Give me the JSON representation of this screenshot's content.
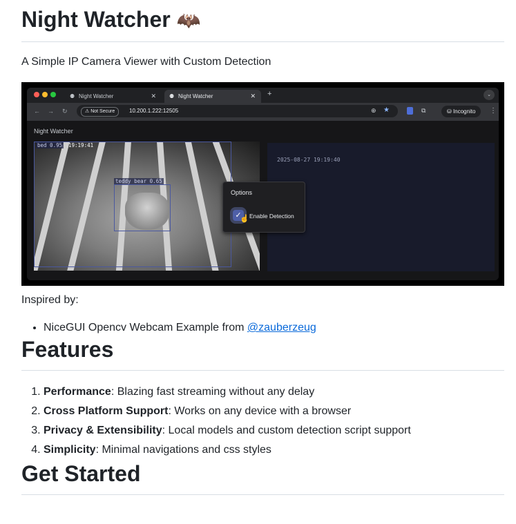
{
  "title": "Night Watcher",
  "title_emoji": "🦇",
  "subtitle": "A Simple IP Camera Viewer with Custom Detection",
  "screenshot": {
    "tabs": [
      "Night Watcher",
      "Night Watcher"
    ],
    "new_tab": "+",
    "nav_icons": [
      "back-icon",
      "forward-icon",
      "reload-icon"
    ],
    "security_label": "⚠ Not Secure",
    "url": "10.200.1.222:12505",
    "incognito_label": "Incognito",
    "app_title": "Night Watcher",
    "detections": [
      {
        "label": "bed 0.95"
      },
      {
        "label": "teddy bear 0.65"
      }
    ],
    "cam_time": "19:19:41",
    "timestamp": "2025-08-27 19:19:40",
    "options_title": "Options",
    "enable_detection_label": "Enable Detection",
    "enable_detection_checked": true
  },
  "inspired_by": "Inspired by:",
  "inspired_item": {
    "text": "NiceGUI Opencv Webcam Example from ",
    "link": "@zauberzeug"
  },
  "features_heading": "Features",
  "features": [
    {
      "name": "Performance",
      "desc": ": Blazing fast streaming without any delay"
    },
    {
      "name": "Cross Platform Support",
      "desc": ": Works on any device with a browser"
    },
    {
      "name": "Privacy & Extensibility",
      "desc": ": Local models and custom detection script support"
    },
    {
      "name": "Simplicity",
      "desc": ": Minimal navigations and css styles"
    }
  ],
  "get_started_heading": "Get Started",
  "colors": {
    "link": "#0969da",
    "text": "#1f2328",
    "rule": "#d8dee4"
  }
}
